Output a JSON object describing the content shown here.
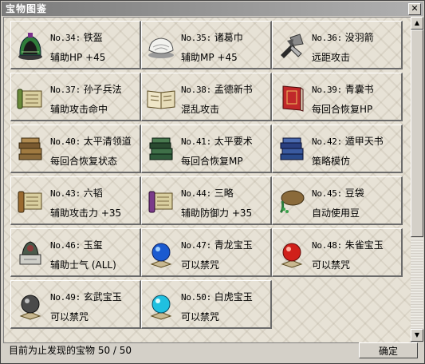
{
  "window": {
    "title": "宝物图鉴",
    "close_label": "✕"
  },
  "items": [
    {
      "no": "No.34:",
      "name": "铁盔",
      "desc": "辅助HP +45",
      "icon": "helmet-icon"
    },
    {
      "no": "No.35:",
      "name": "诸葛巾",
      "desc": "辅助MP +45",
      "icon": "headscarf-icon"
    },
    {
      "no": "No.36:",
      "name": "没羽箭",
      "desc": "远距攻击",
      "icon": "dart-icon"
    },
    {
      "no": "No.37:",
      "name": "孙子兵法",
      "desc": "辅助攻击命中",
      "icon": "scroll-icon"
    },
    {
      "no": "No.38:",
      "name": "孟德新书",
      "desc": "混乱攻击",
      "icon": "open-book-icon"
    },
    {
      "no": "No.39:",
      "name": "青囊书",
      "desc": "每回合恢复HP",
      "icon": "red-book-icon"
    },
    {
      "no": "No.40:",
      "name": "太平清领道",
      "desc": "每回合恢复状态",
      "icon": "book-stack-brown-icon"
    },
    {
      "no": "No.41:",
      "name": "太平要术",
      "desc": "每回合恢复MP",
      "icon": "book-stack-green-icon"
    },
    {
      "no": "No.42:",
      "name": "遁甲天书",
      "desc": "策略模仿",
      "icon": "book-stack-blue-icon"
    },
    {
      "no": "No.43:",
      "name": "六韬",
      "desc": "辅助攻击力 +35",
      "icon": "scroll-brown-icon"
    },
    {
      "no": "No.44:",
      "name": "三略",
      "desc": "辅助防御力 +35",
      "icon": "scroll-purple-icon"
    },
    {
      "no": "No.45:",
      "name": "豆袋",
      "desc": "自动使用豆",
      "icon": "bean-bag-icon"
    },
    {
      "no": "No.46:",
      "name": "玉玺",
      "desc": "辅助士气 (ALL)",
      "icon": "jade-seal-icon"
    },
    {
      "no": "No.47:",
      "name": "青龙宝玉",
      "desc": "可以禁咒",
      "icon": "blue-orb-icon"
    },
    {
      "no": "No.48:",
      "name": "朱雀宝玉",
      "desc": "可以禁咒",
      "icon": "red-orb-icon"
    },
    {
      "no": "No.49:",
      "name": "玄武宝玉",
      "desc": "可以禁咒",
      "icon": "gray-orb-icon"
    },
    {
      "no": "No.50:",
      "name": "白虎宝玉",
      "desc": "可以禁咒",
      "icon": "cyan-orb-icon"
    }
  ],
  "status": {
    "text": "目前为止发现的宝物 50 / 50"
  },
  "buttons": {
    "ok": "确定"
  },
  "scrollbar": {
    "up": "▲",
    "down": "▼"
  }
}
